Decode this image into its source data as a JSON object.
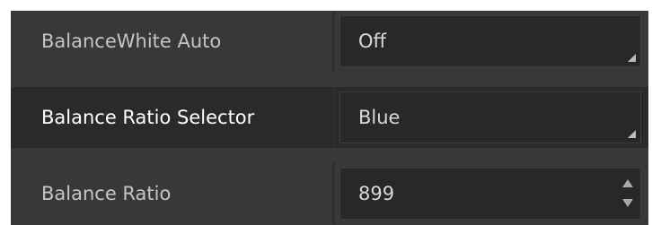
{
  "properties": [
    {
      "label": "BalanceWhite Auto",
      "value": "Off",
      "control": "dropdown",
      "selected": false
    },
    {
      "label": "Balance Ratio Selector",
      "value": "Blue",
      "control": "dropdown",
      "selected": true
    },
    {
      "label": "Balance Ratio",
      "value": "899",
      "control": "spinbox",
      "selected": false
    }
  ],
  "icons": {
    "dropdown_grip": "resize-grip-icon",
    "spin_up": "spin-up-arrow-icon",
    "spin_down": "spin-down-arrow-icon"
  },
  "colors": {
    "panel_background": "#383838",
    "selected_row_background": "#2a2a2a",
    "field_background": "#282828",
    "label_text": "#c5c5c5",
    "selected_label_text": "#ffffff"
  }
}
